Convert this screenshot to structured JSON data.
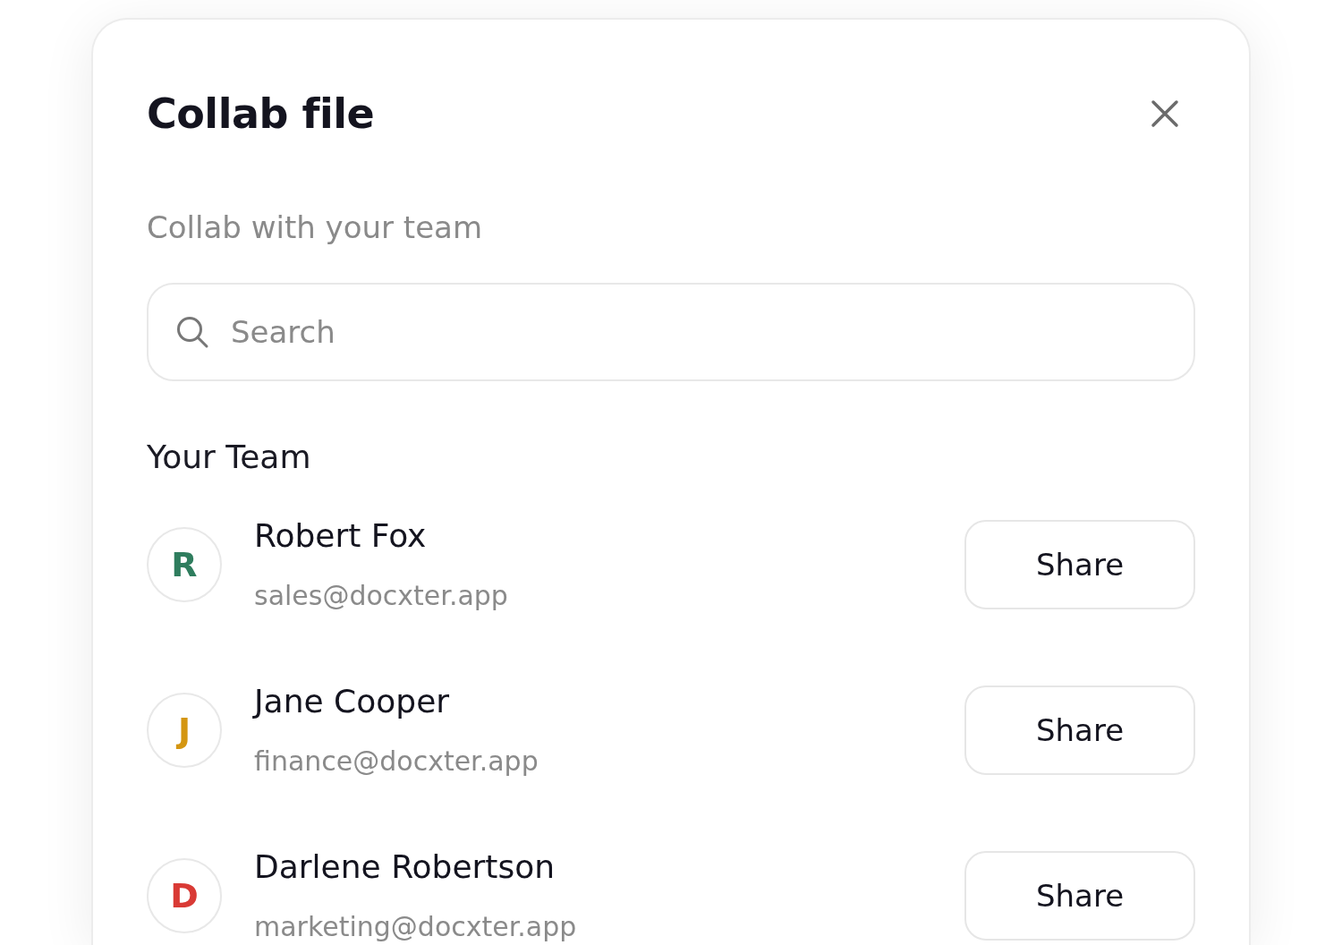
{
  "dialog": {
    "title": "Collab file",
    "subtitle": "Collab with your team",
    "search": {
      "placeholder": "Search"
    },
    "section_title": "Your Team",
    "members": [
      {
        "initial": "R",
        "color": "#2f7d5e",
        "name": "Robert Fox",
        "email": "sales@docxter.app",
        "action": "Share"
      },
      {
        "initial": "J",
        "color": "#d49611",
        "name": "Jane Cooper",
        "email": "finance@docxter.app",
        "action": "Share"
      },
      {
        "initial": "D",
        "color": "#d93a35",
        "name": "Darlene Robertson",
        "email": "marketing@docxter.app",
        "action": "Share"
      }
    ]
  }
}
